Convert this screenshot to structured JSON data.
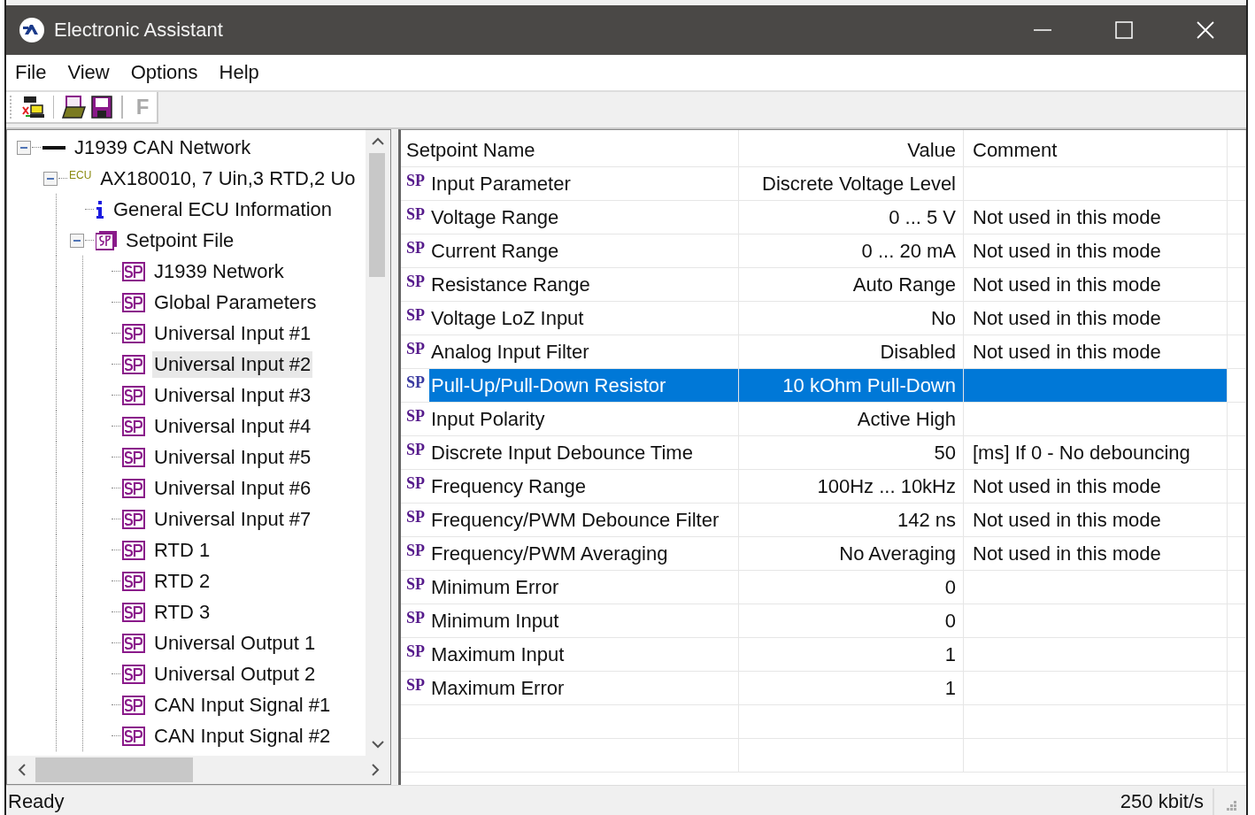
{
  "window": {
    "title": "Electronic Assistant"
  },
  "menu": [
    "File",
    "View",
    "Options",
    "Help"
  ],
  "toolbar": {
    "groups": [
      [
        {
          "kind": "can"
        }
      ],
      [
        {
          "kind": "sp-open"
        },
        {
          "kind": "sp-save"
        }
      ],
      [
        {
          "kind": "letter",
          "label": "F",
          "disabled": true
        }
      ]
    ]
  },
  "tree": [
    {
      "label": "J1939 CAN Network",
      "kind": "network",
      "expanded": true,
      "selected": false,
      "children": [
        {
          "label": "AX180010, 7 Uin,3 RTD,2 Uo",
          "kind": "ecu",
          "badge": "ECU",
          "expanded": true,
          "selected": false,
          "children": [
            {
              "label": "General ECU Information",
              "kind": "info",
              "selected": false
            },
            {
              "label": "Setpoint File",
              "kind": "sp-file",
              "expanded": true,
              "selected": false,
              "children": [
                {
                  "label": "J1939 Network",
                  "kind": "sp",
                  "selected": false
                },
                {
                  "label": "Global Parameters",
                  "kind": "sp",
                  "selected": false
                },
                {
                  "label": "Universal Input #1",
                  "kind": "sp",
                  "selected": false
                },
                {
                  "label": "Universal Input #2",
                  "kind": "sp",
                  "selected": true
                },
                {
                  "label": "Universal Input #3",
                  "kind": "sp",
                  "selected": false
                },
                {
                  "label": "Universal Input #4",
                  "kind": "sp",
                  "selected": false
                },
                {
                  "label": "Universal Input #5",
                  "kind": "sp",
                  "selected": false
                },
                {
                  "label": "Universal Input #6",
                  "kind": "sp",
                  "selected": false
                },
                {
                  "label": "Universal Input #7",
                  "kind": "sp",
                  "selected": false
                },
                {
                  "label": "RTD 1",
                  "kind": "sp",
                  "selected": false
                },
                {
                  "label": "RTD 2",
                  "kind": "sp",
                  "selected": false
                },
                {
                  "label": "RTD 3",
                  "kind": "sp",
                  "selected": false
                },
                {
                  "label": "Universal Output 1",
                  "kind": "sp",
                  "selected": false
                },
                {
                  "label": "Universal Output 2",
                  "kind": "sp",
                  "selected": false
                },
                {
                  "label": "CAN Input Signal #1",
                  "kind": "sp",
                  "selected": false
                },
                {
                  "label": "CAN Input Signal #2",
                  "kind": "sp",
                  "selected": false
                }
              ]
            }
          ]
        }
      ]
    }
  ],
  "table": {
    "columns": [
      "Setpoint Name",
      "Value",
      "Comment"
    ],
    "rows": [
      {
        "marker": "SP",
        "name": "Input Parameter",
        "value": "Discrete Voltage Level",
        "comment": "",
        "selected": false
      },
      {
        "marker": "SP",
        "name": "Voltage Range",
        "value": "0 ... 5 V",
        "comment": "Not used in this mode",
        "selected": false
      },
      {
        "marker": "SP",
        "name": "Current Range",
        "value": "0 ... 20 mA",
        "comment": "Not used in this mode",
        "selected": false
      },
      {
        "marker": "SP",
        "name": "Resistance Range",
        "value": "Auto Range",
        "comment": "Not used in this mode",
        "selected": false
      },
      {
        "marker": "SP",
        "name": "Voltage LoZ Input",
        "value": "No",
        "comment": "Not used in this mode",
        "selected": false
      },
      {
        "marker": "SP",
        "name": "Analog Input Filter",
        "value": "Disabled",
        "comment": "Not used in this mode",
        "selected": false
      },
      {
        "marker": "SP",
        "name": "Pull-Up/Pull-Down Resistor",
        "value": "10 kOhm Pull-Down",
        "comment": "",
        "selected": true
      },
      {
        "marker": "SP",
        "name": "Input Polarity",
        "value": "Active High",
        "comment": "",
        "selected": false
      },
      {
        "marker": "SP",
        "name": "Discrete Input Debounce Time",
        "value": "50",
        "comment": "[ms]  If 0 - No debouncing",
        "selected": false
      },
      {
        "marker": "SP",
        "name": "Frequency Range",
        "value": "100Hz ... 10kHz",
        "comment": "Not used in this mode",
        "selected": false
      },
      {
        "marker": "SP",
        "name": "Frequency/PWM Debounce Filter",
        "value": "142 ns",
        "comment": "Not used in this mode",
        "selected": false
      },
      {
        "marker": "SP",
        "name": "Frequency/PWM Averaging",
        "value": "No Averaging",
        "comment": "Not used in this mode",
        "selected": false
      },
      {
        "marker": "SP",
        "name": "Minimum Error",
        "value": "0",
        "comment": "",
        "selected": false
      },
      {
        "marker": "SP",
        "name": "Minimum Input",
        "value": "0",
        "comment": "",
        "selected": false
      },
      {
        "marker": "SP",
        "name": "Maximum Input",
        "value": "1",
        "comment": "",
        "selected": false
      },
      {
        "marker": "SP",
        "name": "Maximum Error",
        "value": "1",
        "comment": "",
        "selected": false
      }
    ]
  },
  "status_bar": {
    "message": "Ready",
    "bitrate": "250 kbit/s"
  }
}
